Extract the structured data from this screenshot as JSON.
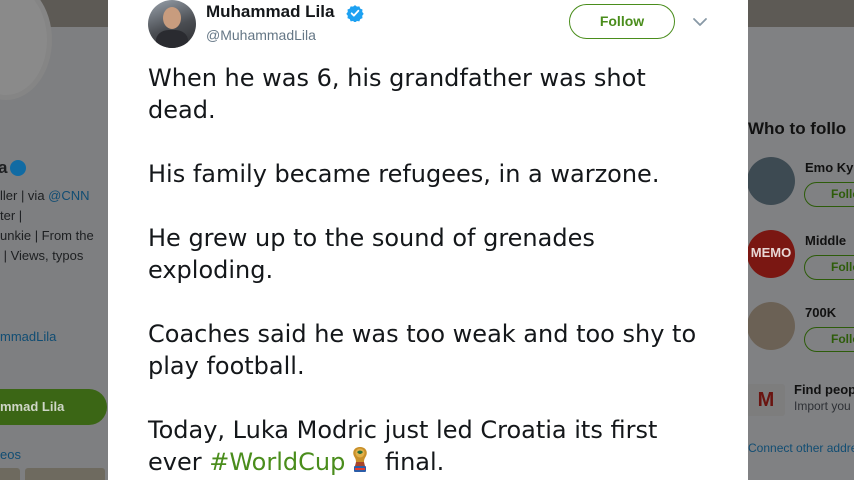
{
  "background": {
    "profile": {
      "name_fragment": "a",
      "bio_lines": [
        "ller | via ",
        "ter |",
        "unkie | From the",
        " | Views, typos"
      ],
      "bio_link": "@CNN",
      "handle_fragment": "mmadLila",
      "follow_button_fragment": "mmad Lila",
      "videos_fragment": "eos"
    },
    "who_to_follow": {
      "title": "Who to follo",
      "items": [
        {
          "name": "Emo Ky",
          "follow_label": "Follo"
        },
        {
          "name": "Middle",
          "follow_label": "Follo",
          "avatar_text": "MEMO"
        },
        {
          "name": "700K",
          "follow_label": "Follo"
        }
      ],
      "find_people": {
        "title": "Find peop",
        "subtitle": "Import you"
      },
      "connect": "Connect other addre"
    }
  },
  "tweet": {
    "author": {
      "name": "Muhammad Lila",
      "handle": "@MuhammadLila",
      "verified": true
    },
    "follow_label": "Follow",
    "paragraphs": [
      "When he was 6, his grandfather was shot dead.",
      "His family became refugees, in a warzone.",
      "He grew up to the sound of grenades exploding.",
      "Coaches said he was too weak and too shy to play football."
    ],
    "last_paragraph": {
      "before": "Today, Luka Modric just led Croatia its first ever ",
      "hashtag": "#WorldCup",
      "emoji": "world-cup-trophy-emoji",
      "after": " final."
    }
  },
  "colors": {
    "accent": "#4a8d1c",
    "verified": "#1da1f2",
    "text": "#14171a",
    "secondary": "#657786",
    "overlay": "#7f8082"
  }
}
